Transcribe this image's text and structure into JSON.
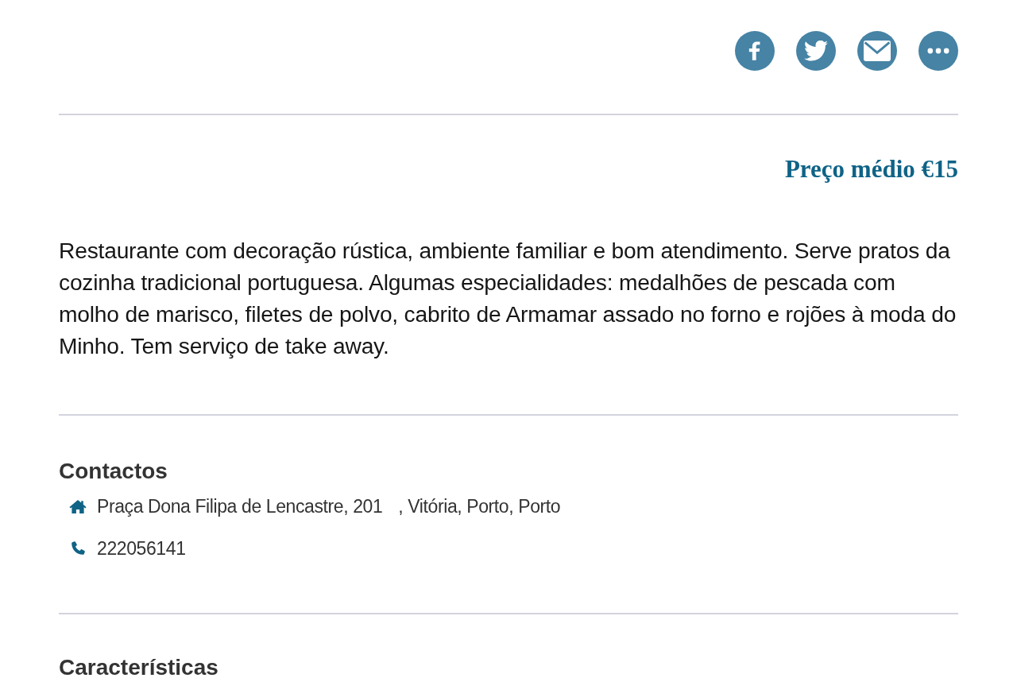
{
  "share_buttons": [
    {
      "kind": "facebook"
    },
    {
      "kind": "twitter"
    },
    {
      "kind": "email"
    },
    {
      "kind": "more"
    }
  ],
  "price": "Preço médio €15",
  "description": "Restaurante com decoração rústica, ambiente familiar e bom atendimento. Serve pratos da cozinha tradicional portuguesa. Algumas especialidades: medalhões de pescada com molho de marisco, filetes de polvo, cabrito de Armamar assado no forno e rojões à moda do Minho. Tem serviço de take away.",
  "contacts": {
    "title": "Contactos",
    "items": [
      {
        "kind": "address",
        "parts": [
          "Praça Dona Filipa de Lencastre, 201",
          ", Vitória, Porto, Porto"
        ]
      },
      {
        "kind": "phone",
        "parts": [
          "222056141"
        ]
      }
    ]
  },
  "features": {
    "title": "Características"
  }
}
